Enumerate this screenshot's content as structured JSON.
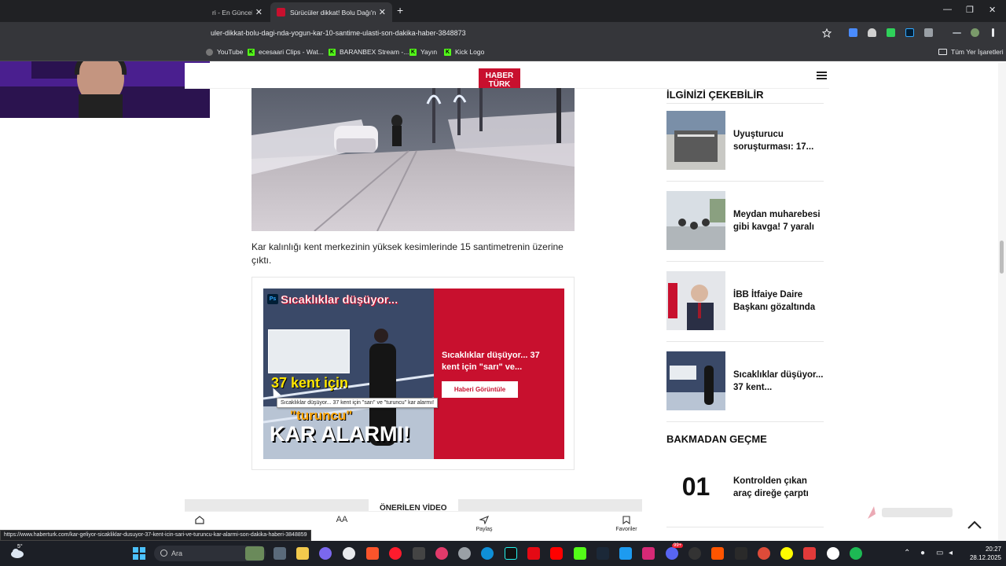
{
  "browser": {
    "tabs": [
      {
        "label": "ri - En Güncel",
        "active": false
      },
      {
        "label": "Sürücüler dikkat! Bolu Dağı'nda",
        "active": true
      }
    ],
    "new_tab_symbol": "+",
    "close_symbol": "✕",
    "window_controls": [
      "—",
      "❐",
      "✕"
    ],
    "url": "uler-dikkat-bolu-dagi-nda-yogun-kar-10-santime-ulasti-son-dakika-haber-3848873",
    "bookmarks": [
      "YouTube",
      "ecesaari Clips - Wat...",
      "BARANBEX Stream -...",
      "Yayın",
      "Kick Logo"
    ],
    "bookmarks_folder": "Tüm Yer İşaretleri",
    "status_url": "https://www.haberturk.com/kar-geliyor-sicakliklar-dusuyor-37-kent-icin-sari-ve-turuncu-kar-alarmi-son-dakika-haberi-3848859"
  },
  "site": {
    "logo_top": "HABER",
    "logo_bottom": "TÜRK"
  },
  "article": {
    "body_text": "Kar kalınlığı kent merkezinin yüksek kesimlerinde 15 santimetrenin üzerine çıktı.",
    "promo": {
      "image_title": "Sıcaklıklar düşüyor...",
      "ps_badge": "Ps",
      "image_line1": "37 kent için",
      "image_line2": "\"turuncu\"",
      "image_line3": "KAR ALARMI!",
      "text": "Sıcaklıklar düşüyor... 37 kent için \"sarı\" ve...",
      "button": "Haberi Görüntüle",
      "tooltip": "Sıcaklıklar düşüyor... 37 kent için \"sarı\" ve \"turuncu\" kar alarmı!"
    },
    "recommended_video": "ÖNERİLEN VİDEO"
  },
  "bottom_nav": {
    "share": "Paylaş",
    "favorites": "Favoriler",
    "font_icon": "AA"
  },
  "sidebar": {
    "heading1": "İLGİNİZİ ÇEKEBİLİR",
    "items": [
      {
        "title": "Uyuşturucu soruşturması: 17..."
      },
      {
        "title": "Meydan muharebesi gibi kavga! 7 yaralı"
      },
      {
        "title": "İBB İtfaiye Daire Başkanı gözaltında"
      },
      {
        "title": "Sıcaklıklar düşüyor... 37 kent..."
      }
    ],
    "heading2": "BAKMADAN GEÇME",
    "rank": "01",
    "rank_title": "Kontrolden çıkan araç direğe çarptı"
  },
  "taskbar": {
    "temperature": "5°",
    "search": "Ara",
    "time": "20:27",
    "date": "28.12.2025",
    "badge": "99+"
  },
  "colors": {
    "brand_red": "#c8102e",
    "kick_green": "#53fc18",
    "chrome_dark": "#202124",
    "chrome_mid": "#35363a"
  }
}
